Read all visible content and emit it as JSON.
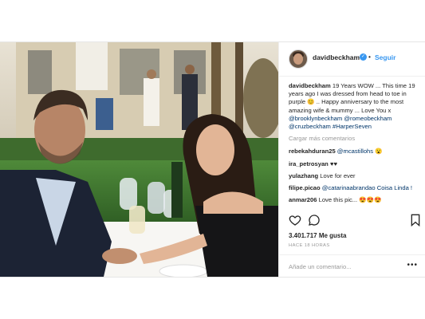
{
  "post": {
    "username": "davidbeckham",
    "follow_label": "Seguir",
    "separator": "•",
    "caption": {
      "user": "davidbeckham",
      "text": "19 Years WOW ... This time 19 years ago I was dressed from head to toe in purple 😊 .. Happy anniversary to the most amazing wife & mummy ... Love You x ",
      "mentions": "@brooklynbeckham @romeobeckham @cruzbeckham #HarperSeven"
    },
    "load_more": "Cargar más comentarios",
    "comments": [
      {
        "user": "rebekahduran25",
        "text": "@mcastillohs 😮"
      },
      {
        "user": "ira_petrosyan",
        "text": "♥♥"
      },
      {
        "user": "yulazhang",
        "text": "Love for ever"
      },
      {
        "user": "filipe.picao",
        "text": "@catarinaabrandao Coisa Linda !"
      },
      {
        "user": "anmar206",
        "text": "Love this pic... 😍😍😍"
      }
    ],
    "likes": "3.401.717 Me gusta",
    "timestamp": "HACE 18 HORAS",
    "add_comment_placeholder": "Añade un comentario...",
    "options": "•••",
    "icons": [
      "heart-icon",
      "comment-icon",
      "bookmark-icon",
      "verified-badge-icon",
      "more-options-icon"
    ],
    "colors": {
      "link": "#3897f0",
      "text": "#262626",
      "muted": "#999999"
    }
  }
}
